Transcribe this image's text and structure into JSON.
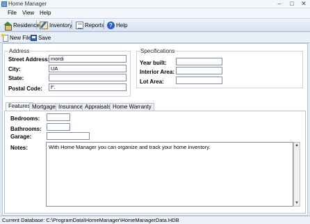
{
  "window": {
    "title": "Home Manager"
  },
  "menu": [
    "File",
    "View",
    "Help"
  ],
  "toolbar": {
    "residence": "Residence",
    "inventory": "Inventory",
    "reports": "Reports",
    "help": "Help"
  },
  "toolbar2": {
    "new_file": "New File",
    "save": "Save"
  },
  "address": {
    "title": "Address",
    "street_label": "Street Address:",
    "street_value": "mordi",
    "city_label": "City:",
    "city_value": "UA",
    "state_label": "State:",
    "state_value": "",
    "postal_label": "Postal Code:",
    "postal_value": "f\"."
  },
  "specs": {
    "title": "Specifications",
    "year_label": "Year built:",
    "year_value": "",
    "interior_label": "Interior Area:",
    "interior_value": "",
    "lot_label": "Lot Area:",
    "lot_value": ""
  },
  "tabs": [
    "Features",
    "Mortgage",
    "Insurance",
    "Appraisals",
    "Home Warranty"
  ],
  "features": {
    "bedrooms_label": "Bedrooms:",
    "bedrooms_value": "",
    "bathrooms_label": "Bathrooms:",
    "bathrooms_value": "",
    "garage_label": "Garage:",
    "garage_value": "",
    "notes_label": "Notes:",
    "notes_value": "With Home Manager you can organize and track your home inventory."
  },
  "status": {
    "text": "Current Database: C:\\ProgramData\\HomeManager\\HomeManagerData.HDB"
  }
}
